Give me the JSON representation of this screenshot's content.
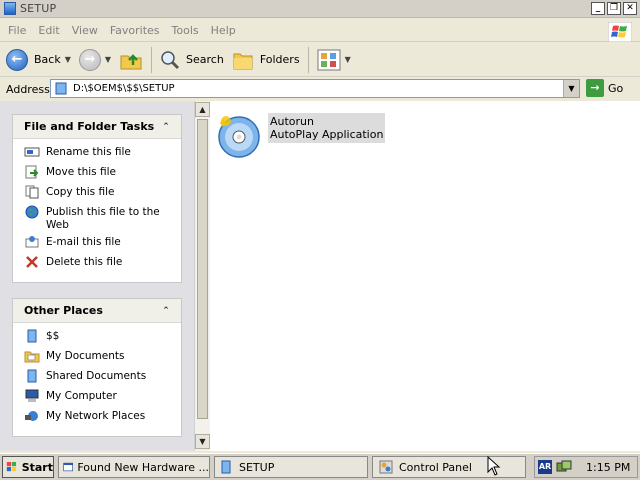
{
  "window": {
    "title": "SETUP"
  },
  "menu": [
    "File",
    "Edit",
    "View",
    "Favorites",
    "Tools",
    "Help"
  ],
  "toolbar": {
    "back": "Back",
    "search": "Search",
    "folders": "Folders"
  },
  "address": {
    "label": "Address",
    "path": "D:\\$OEM$\\$$\\SETUP",
    "go": "Go"
  },
  "tasks": {
    "title": "File and Folder Tasks",
    "items": [
      {
        "label": "Rename this file",
        "icon": "rename-icon"
      },
      {
        "label": "Move this file",
        "icon": "move-icon"
      },
      {
        "label": "Copy this file",
        "icon": "copy-icon"
      },
      {
        "label": "Publish this file to the Web",
        "icon": "globe-icon"
      },
      {
        "label": "E-mail this file",
        "icon": "email-icon"
      },
      {
        "label": "Delete this file",
        "icon": "delete-icon"
      }
    ]
  },
  "places": {
    "title": "Other Places",
    "items": [
      {
        "label": "$$",
        "icon": "folder-icon"
      },
      {
        "label": "My Documents",
        "icon": "my-documents-icon"
      },
      {
        "label": "Shared Documents",
        "icon": "folder-icon"
      },
      {
        "label": "My Computer",
        "icon": "my-computer-icon"
      },
      {
        "label": "My Network Places",
        "icon": "network-places-icon"
      }
    ]
  },
  "file": {
    "name": "Autorun",
    "type": "AutoPlay Application"
  },
  "taskbar": {
    "start": "Start",
    "tasks": [
      "Found New Hardware ...",
      "SETUP",
      "Control Panel"
    ],
    "tray_lang": "AR",
    "clock": "1:15 PM"
  }
}
